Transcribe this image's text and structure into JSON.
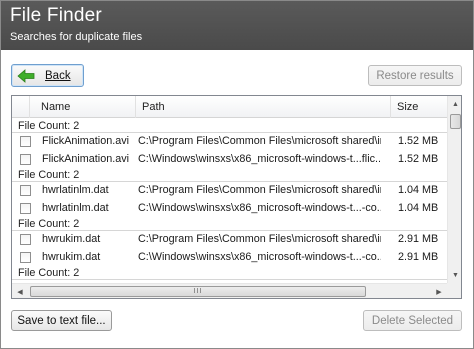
{
  "header": {
    "title": "File Finder",
    "subtitle": "Searches for duplicate files"
  },
  "toolbar": {
    "back_label": "Back",
    "restore_label": "Restore results"
  },
  "list": {
    "columns": [
      "Name",
      "Path",
      "Size"
    ],
    "groups": [
      {
        "label": "File Count: 2",
        "files": [
          {
            "name": "FlickAnimation.avi",
            "path": "C:\\Program Files\\Common Files\\microsoft shared\\ink",
            "size": "1.52 MB"
          },
          {
            "name": "FlickAnimation.avi",
            "path": "C:\\Windows\\winsxs\\x86_microsoft-windows-t...flic...",
            "size": "1.52 MB"
          }
        ]
      },
      {
        "label": "File Count: 2",
        "files": [
          {
            "name": "hwrlatinlm.dat",
            "path": "C:\\Program Files\\Common Files\\microsoft shared\\ink",
            "size": "1.04 MB"
          },
          {
            "name": "hwrlatinlm.dat",
            "path": "C:\\Windows\\winsxs\\x86_microsoft-windows-t...-co...",
            "size": "1.04 MB"
          }
        ]
      },
      {
        "label": "File Count: 2",
        "files": [
          {
            "name": "hwrukim.dat",
            "path": "C:\\Program Files\\Common Files\\microsoft shared\\ink",
            "size": "2.91 MB"
          },
          {
            "name": "hwrukim.dat",
            "path": "C:\\Windows\\winsxs\\x86_microsoft-windows-t...-co...",
            "size": "2.91 MB"
          }
        ]
      },
      {
        "label": "File Count: 2",
        "files": []
      }
    ],
    "hscroll_grip": "III"
  },
  "footer": {
    "save_label": "Save to text file...",
    "delete_label": "Delete Selected"
  },
  "icons": {
    "back": "green-left-arrow-icon"
  },
  "colors": {
    "header_bg": "#4f4f4f",
    "accent_arrow": "#3fae2a"
  }
}
